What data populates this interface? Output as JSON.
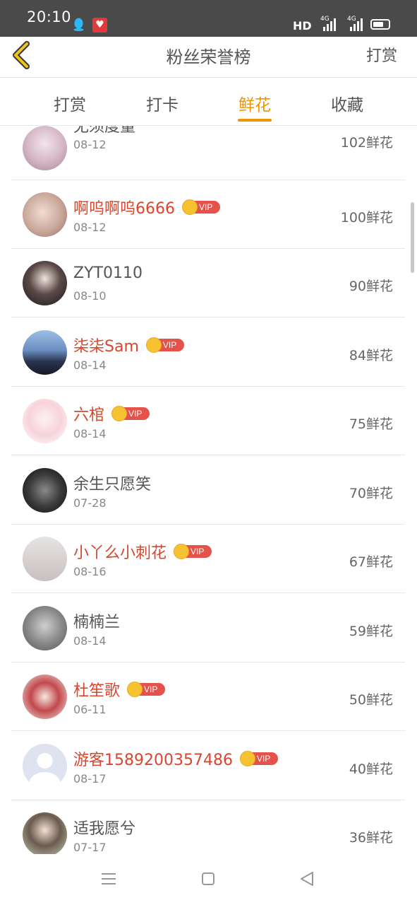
{
  "status": {
    "time": "20:10",
    "network": "HD",
    "net_type_1": "4G",
    "net_type_2": "4G"
  },
  "nav": {
    "title": "粉丝荣誉榜",
    "action": "打赏"
  },
  "tabs": [
    {
      "label": "打赏",
      "active": false
    },
    {
      "label": "打卡",
      "active": false
    },
    {
      "label": "鲜花",
      "active": true
    },
    {
      "label": "收藏",
      "active": false
    }
  ],
  "vip_label": "VIP",
  "fans": [
    {
      "name": "无须度量",
      "date": "08-12",
      "count": "102鲜花",
      "vip": false
    },
    {
      "name": "啊呜啊呜6666",
      "date": "08-12",
      "count": "100鲜花",
      "vip": true
    },
    {
      "name": "ZYT0110",
      "date": "08-10",
      "count": "90鲜花",
      "vip": false
    },
    {
      "name": "柒柒Sam",
      "date": "08-14",
      "count": "84鲜花",
      "vip": true
    },
    {
      "name": "六棺",
      "date": "08-14",
      "count": "75鲜花",
      "vip": true
    },
    {
      "name": "余生只愿笑",
      "date": "07-28",
      "count": "70鲜花",
      "vip": false
    },
    {
      "name": "小丫么小刺花",
      "date": "08-16",
      "count": "67鲜花",
      "vip": true
    },
    {
      "name": "楠楠兰",
      "date": "08-14",
      "count": "59鲜花",
      "vip": false
    },
    {
      "name": "杜笙歌",
      "date": "06-11",
      "count": "50鲜花",
      "vip": true
    },
    {
      "name": "游客1589200357486",
      "date": "08-17",
      "count": "40鲜花",
      "vip": true
    },
    {
      "name": "适我愿兮",
      "date": "07-17",
      "count": "36鲜花",
      "vip": false
    }
  ],
  "colors": {
    "accent": "#f09500",
    "vip_name": "#d9462d",
    "vip_badge": "#e5524a"
  },
  "icons": {
    "back": "chevron-left-icon",
    "menu": "menu-icon",
    "home": "home-square-icon",
    "nav_back": "triangle-back-icon"
  }
}
